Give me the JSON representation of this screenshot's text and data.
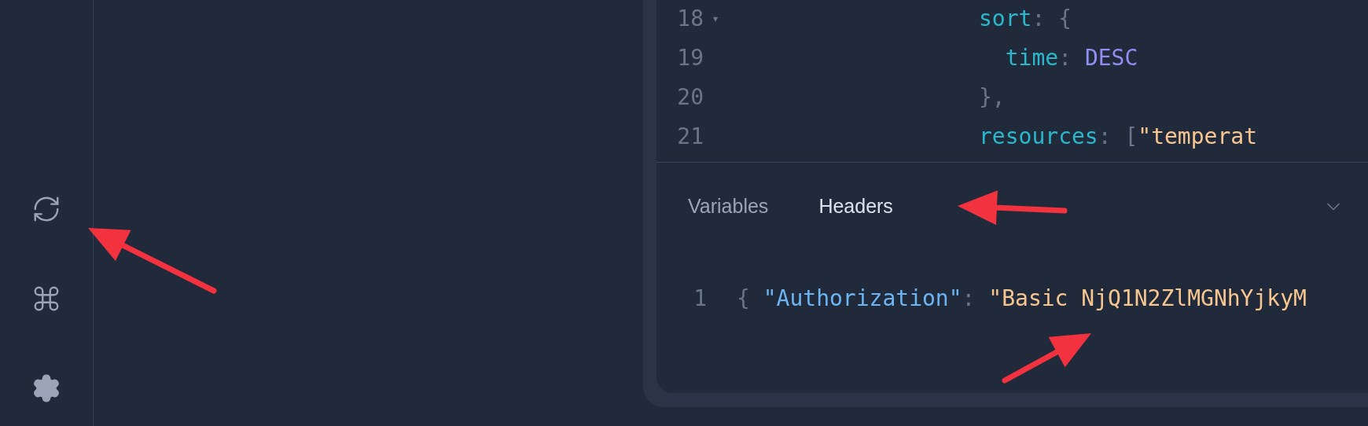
{
  "sidebar": {
    "buttons": [
      {
        "kind": "refresh"
      },
      {
        "kind": "shortcuts"
      },
      {
        "kind": "settings"
      }
    ]
  },
  "query_editor": {
    "lines": [
      {
        "number": "18",
        "fold": "▾",
        "tokens": [
          {
            "kind": "key",
            "text": "sort"
          },
          {
            "kind": "punct",
            "text": ": {"
          }
        ]
      },
      {
        "number": "19",
        "tokens": [
          {
            "kind": "key",
            "text": "  time"
          },
          {
            "kind": "punct",
            "text": ": "
          },
          {
            "kind": "enum",
            "text": "DESC"
          }
        ]
      },
      {
        "number": "20",
        "tokens": [
          {
            "kind": "punct",
            "text": "},"
          }
        ]
      },
      {
        "number": "21",
        "tokens": [
          {
            "kind": "key",
            "text": "resources"
          },
          {
            "kind": "punct",
            "text": ": ["
          },
          {
            "kind": "string",
            "text": "\"temperat"
          }
        ]
      }
    ]
  },
  "tabs": [
    {
      "label": "Variables",
      "selected": false
    },
    {
      "label": "Headers",
      "selected": true
    }
  ],
  "headers_editor": {
    "lines": [
      {
        "number": "1",
        "tokens": [
          {
            "kind": "punct",
            "text": "{ "
          },
          {
            "kind": "prop",
            "text": "\"Authorization\""
          },
          {
            "kind": "punct",
            "text": ": "
          },
          {
            "kind": "string",
            "text": "\"Basic NjQ1N2ZlMGNhYjkyM"
          }
        ]
      }
    ]
  }
}
